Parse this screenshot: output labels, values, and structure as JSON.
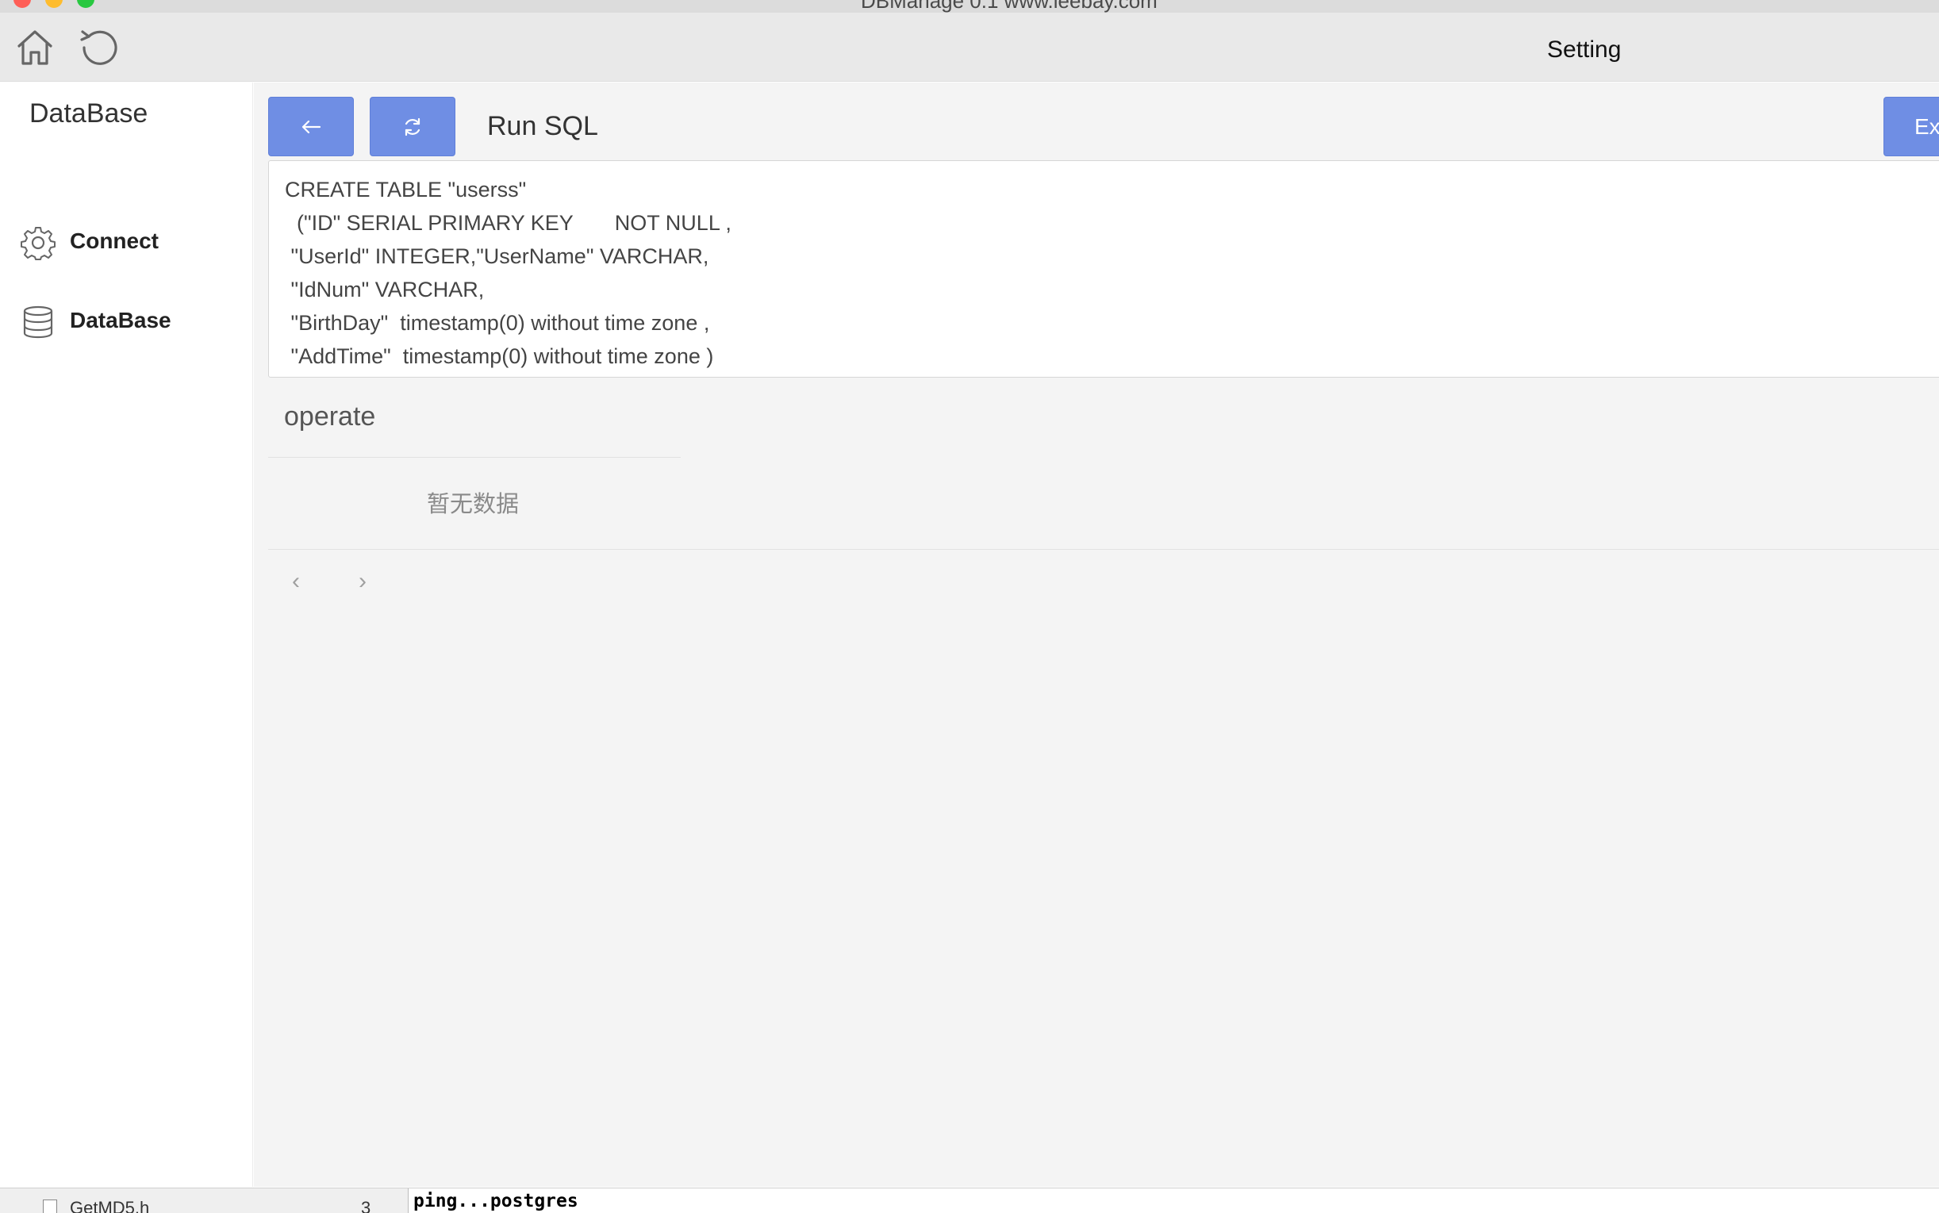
{
  "window": {
    "title": "DBManage 0.1 www.ieebay.com"
  },
  "toolbar": {
    "home_icon": "home-icon",
    "reload_icon": "reload-icon",
    "title": "Setting"
  },
  "sidebar": {
    "header": "DataBase",
    "items": [
      {
        "label": "Connect",
        "icon": "gear-icon"
      },
      {
        "label": "DataBase",
        "icon": "database-icon"
      }
    ]
  },
  "main": {
    "title": "Run SQL",
    "execute_label": "Ex",
    "sql_text": "CREATE TABLE \"userss\"\n  (\"ID\" SERIAL PRIMARY KEY       NOT NULL ,\n \"UserId\" INTEGER,\"UserName\" VARCHAR,\n \"IdNum\" VARCHAR,\n \"BirthDay\"  timestamp(0) without time zone ,\n \"AddTime\"  timestamp(0) without time zone )",
    "table": {
      "column_header": "operate",
      "empty_text": "暂无数据"
    },
    "pager": {
      "prev": "‹",
      "next": "›"
    }
  },
  "bottom": {
    "filename": "GetMD5.h",
    "count": "3",
    "console_text": "ping...postgres"
  },
  "colors": {
    "accent": "#6f8ee4",
    "toolbar_bg": "#e9e9e9",
    "main_bg": "#f4f4f4"
  }
}
